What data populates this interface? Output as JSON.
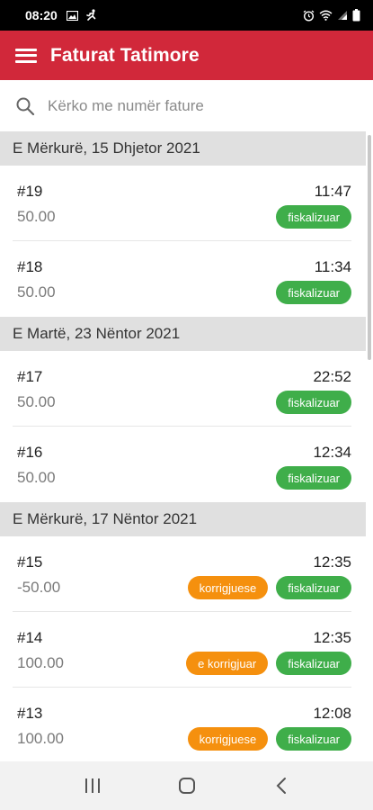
{
  "status_bar": {
    "time": "08:20",
    "left_icons": [
      "image-icon",
      "running-icon"
    ],
    "right_icons": [
      "alarm-icon",
      "wifi-icon",
      "signal-icon",
      "battery-icon"
    ]
  },
  "app_bar": {
    "title": "Faturat Tatimore"
  },
  "search": {
    "placeholder": "Kërko me numër fature"
  },
  "colors": {
    "primary": "#d1283a",
    "badge_fiscalized": "#3fae4a",
    "badge_correction": "#f5900e"
  },
  "groups": [
    {
      "date": "E Mërkurë, 15 Dhjetor 2021",
      "invoices": [
        {
          "number": "#19",
          "time": "11:47",
          "amount": "50.00",
          "badges": [
            {
              "label": "fiskalizuar",
              "color": "green"
            }
          ]
        },
        {
          "number": "#18",
          "time": "11:34",
          "amount": "50.00",
          "badges": [
            {
              "label": "fiskalizuar",
              "color": "green"
            }
          ]
        }
      ]
    },
    {
      "date": "E Martë, 23 Nëntor 2021",
      "invoices": [
        {
          "number": "#17",
          "time": "22:52",
          "amount": "50.00",
          "badges": [
            {
              "label": "fiskalizuar",
              "color": "green"
            }
          ]
        },
        {
          "number": "#16",
          "time": "12:34",
          "amount": "50.00",
          "badges": [
            {
              "label": "fiskalizuar",
              "color": "green"
            }
          ]
        }
      ]
    },
    {
      "date": "E Mërkurë, 17 Nëntor 2021",
      "invoices": [
        {
          "number": "#15",
          "time": "12:35",
          "amount": "-50.00",
          "badges": [
            {
              "label": "korrigjuese",
              "color": "orange"
            },
            {
              "label": "fiskalizuar",
              "color": "green"
            }
          ]
        },
        {
          "number": "#14",
          "time": "12:35",
          "amount": "100.00",
          "badges": [
            {
              "label": "e korrigjuar",
              "color": "orange"
            },
            {
              "label": "fiskalizuar",
              "color": "green"
            }
          ]
        },
        {
          "number": "#13",
          "time": "12:08",
          "amount": "100.00",
          "badges": [
            {
              "label": "korrigjuese",
              "color": "orange"
            },
            {
              "label": "fiskalizuar",
              "color": "green"
            }
          ]
        }
      ]
    }
  ],
  "nav_bar": {
    "buttons": [
      "recents-icon",
      "home-icon",
      "back-icon"
    ]
  }
}
